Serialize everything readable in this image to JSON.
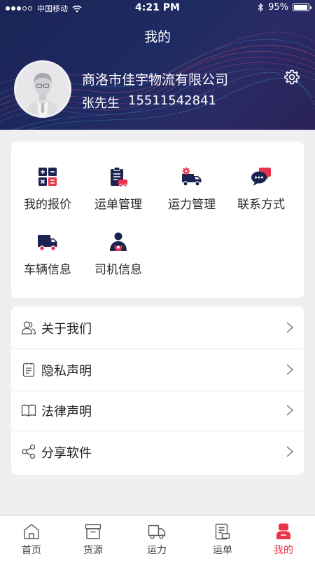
{
  "status_bar": {
    "carrier": "中国移动",
    "time": "4:21 PM",
    "battery": "95%",
    "battery_level": 0.95
  },
  "header": {
    "title": "我的",
    "company": "商洛市佳宇物流有限公司",
    "contact_name": "张先生",
    "phone": "15511542841"
  },
  "functions": [
    {
      "label": "我的报价",
      "icon": "calculator-icon"
    },
    {
      "label": "运单管理",
      "icon": "waybill-clipboard-icon"
    },
    {
      "label": "运力管理",
      "icon": "truck-gear-icon"
    },
    {
      "label": "联系方式",
      "icon": "chat-bubbles-icon"
    },
    {
      "label": "车辆信息",
      "icon": "truck-icon"
    },
    {
      "label": "司机信息",
      "icon": "driver-icon"
    }
  ],
  "menu": [
    {
      "label": "关于我们",
      "icon": "users-icon"
    },
    {
      "label": "隐私声明",
      "icon": "document-icon"
    },
    {
      "label": "法律声明",
      "icon": "book-icon"
    },
    {
      "label": "分享软件",
      "icon": "share-icon"
    }
  ],
  "tabs": [
    {
      "label": "首页",
      "icon": "home-icon",
      "active": false
    },
    {
      "label": "货源",
      "icon": "cargo-box-icon",
      "active": false
    },
    {
      "label": "运力",
      "icon": "truck-outline-icon",
      "active": false
    },
    {
      "label": "运单",
      "icon": "waybill-icon",
      "active": false
    },
    {
      "label": "我的",
      "icon": "profile-icon",
      "active": true
    }
  ],
  "colors": {
    "header_bg": "#1e2a62",
    "accent_red": "#e8334a",
    "icon_navy": "#1b2350"
  }
}
